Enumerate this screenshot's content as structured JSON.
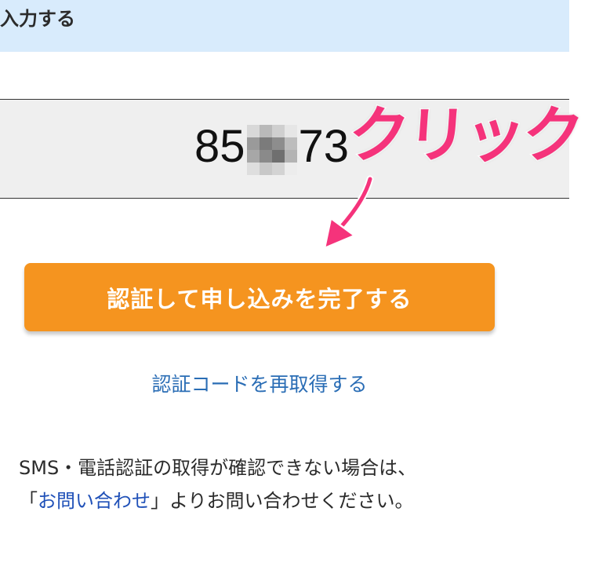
{
  "header": {
    "title": "入力する"
  },
  "code_display": {
    "prefix": "85",
    "suffix": "73",
    "masked": true
  },
  "annotation": {
    "label": "クリック",
    "color": "#f5337b"
  },
  "submit_button": {
    "label": "認証して申し込みを完了する",
    "color": "#f5941f"
  },
  "resend_link": {
    "label": "認証コードを再取得する"
  },
  "notice": {
    "line1": "SMS・電話認証の取得が確認できない場合は、",
    "line2_open": "「",
    "line2_link": "お問い合わせ",
    "line2_close": "」よりお問い合わせください。"
  }
}
